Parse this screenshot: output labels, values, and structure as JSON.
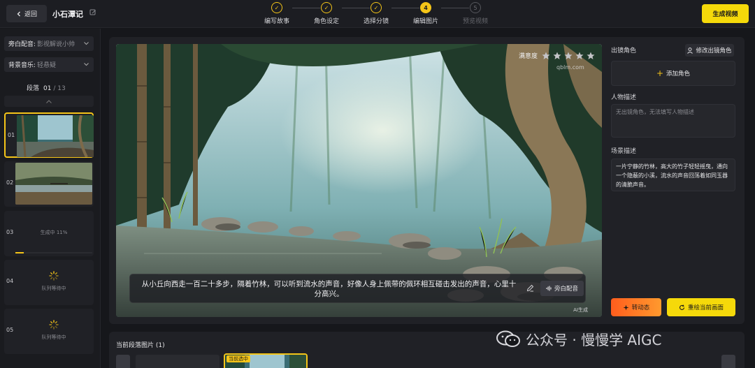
{
  "header": {
    "back_label": "返回",
    "project_title": "小石潭记",
    "generate_video_label": "生成视频",
    "steps": [
      {
        "label": "编写故事",
        "state": "done",
        "mark": "✓"
      },
      {
        "label": "角色设定",
        "state": "done",
        "mark": "✓"
      },
      {
        "label": "选择分镜",
        "state": "done",
        "mark": "✓"
      },
      {
        "label": "编辑图片",
        "state": "current",
        "mark": "4"
      },
      {
        "label": "预览视频",
        "state": "todo",
        "mark": "5"
      }
    ]
  },
  "sidebar": {
    "narration_key": "旁白配音:",
    "narration_value": "影视解说小帅",
    "music_key": "背景音乐:",
    "music_value": "轻悬疑",
    "segment_label": "段落",
    "segment_current": "01",
    "segment_total": "/ 13",
    "segments": [
      {
        "num": "01",
        "state": "done",
        "status": ""
      },
      {
        "num": "02",
        "state": "done",
        "status": ""
      },
      {
        "num": "03",
        "state": "generating",
        "status": "生成中 11%",
        "progress": 0.11
      },
      {
        "num": "04",
        "state": "queued",
        "status": "队列等待中"
      },
      {
        "num": "05",
        "state": "queued",
        "status": "队列等待中"
      }
    ]
  },
  "editor": {
    "rating_label": "满意度",
    "rating_stars": 5,
    "caption": "从小丘向西走一百二十多步，隔着竹林，可以听到流水的声音，好像人身上佩带的佩环相互碰击发出的声音，心里十分高兴。",
    "narration_button": "旁白配音",
    "ai_tag": "AI生成",
    "image_watermark": "qblm.com",
    "characters_title": "出镜角色",
    "edit_characters_label": "修改出镜角色",
    "add_character_label": "添加角色",
    "person_desc_title": "人物描述",
    "person_desc_placeholder": "无出镜角色，无法填写人物描述",
    "scene_desc_title": "场景描述",
    "scene_desc_text": "一片宁静的竹林，高大的竹子轻轻摇曳，通向一个隐蔽的小溪，流水的声音回荡着如同玉器的清脆声音。",
    "animate_label": "转动态",
    "redraw_label": "重绘当前画面"
  },
  "strip": {
    "title": "当前段落图片 (1)",
    "current_badge": "当前选中"
  },
  "watermark": {
    "text": "公众号 · 慢慢学 AIGC"
  },
  "colors": {
    "accent": "#f5c518",
    "button_yellow": "#f5d90a",
    "orange": "#ff6a20",
    "background": "#16171b",
    "panel": "#202126"
  }
}
